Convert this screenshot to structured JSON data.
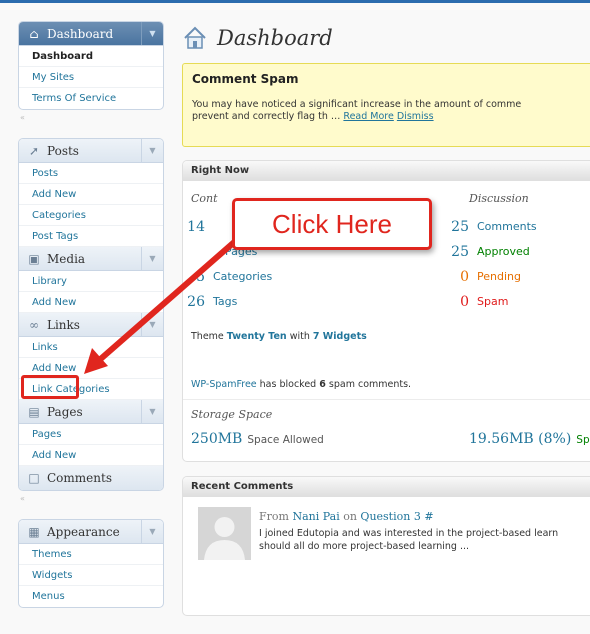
{
  "sidebar": {
    "dashboard": {
      "label": "Dashboard",
      "items": [
        "Dashboard",
        "My Sites",
        "Terms Of Service"
      ]
    },
    "posts": {
      "label": "Posts",
      "items": [
        "Posts",
        "Add New",
        "Categories",
        "Post Tags"
      ]
    },
    "media": {
      "label": "Media",
      "items": [
        "Library",
        "Add New"
      ]
    },
    "links": {
      "label": "Links",
      "items": [
        "Links",
        "Add New",
        "Link Categories"
      ]
    },
    "pages": {
      "label": "Pages",
      "items": [
        "Pages",
        "Add New"
      ]
    },
    "comments": {
      "label": "Comments"
    },
    "appearance": {
      "label": "Appearance",
      "items": [
        "Themes",
        "Widgets",
        "Menus"
      ]
    }
  },
  "main": {
    "title": "Dashboard",
    "notice": {
      "title": "Comment Spam",
      "line1": "You may have noticed a significant increase in the amount of comme",
      "line2": "prevent and correctly flag th … ",
      "read_more": "Read More",
      "dismiss": "Dismiss"
    },
    "right_now": {
      "title": "Right Now",
      "content_head": "Cont",
      "discussion_head": "Discussion",
      "content": [
        {
          "num": "14",
          "label": ""
        },
        {
          "num": "",
          "label": "Pages"
        },
        {
          "num": "5",
          "label": "Categories"
        },
        {
          "num": "26",
          "label": "Tags"
        }
      ],
      "discussion": [
        {
          "num": "25",
          "label": "Comments",
          "color": "#21759b"
        },
        {
          "num": "25",
          "label": "Approved",
          "color": "#008000"
        },
        {
          "num": "0",
          "label": "Pending",
          "color": "#e66f00"
        },
        {
          "num": "0",
          "label": "Spam",
          "color": "#e01b1b"
        }
      ],
      "theme_pre": "Theme ",
      "theme_name": "Twenty Ten",
      "theme_mid": " with ",
      "theme_widgets": "7 Widgets",
      "spamfree_pre": "WP-SpamFree",
      "spamfree_mid": " has blocked ",
      "spamfree_count": "6",
      "spamfree_post": " spam comments.",
      "storage_head": "Storage Space",
      "space_num": "250MB",
      "space_label": "Space Allowed",
      "used_num": "19.56MB (8%)",
      "used_label": "Sp"
    },
    "recent_comments": {
      "title": "Recent Comments",
      "from": "From ",
      "author": "Nani Pai",
      "on": " on ",
      "post": "Question 3 #",
      "line1": "I joined Edutopia and was interested in the project-based learn",
      "line2": "should all do more project-based learning ..."
    }
  },
  "callout": {
    "text": "Click Here"
  },
  "colors": {
    "accent": "#21759b",
    "highlight": "#e0261e"
  },
  "icons": [
    "house-icon",
    "pushpin-icon",
    "media-icon",
    "links-icon",
    "pages-icon",
    "comments-icon",
    "appearance-icon",
    "dashboard-title-icon"
  ]
}
